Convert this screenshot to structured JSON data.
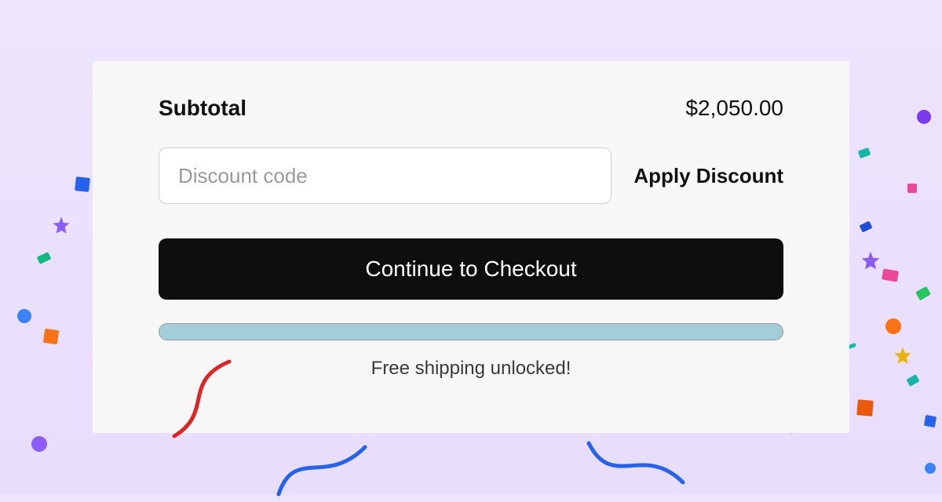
{
  "subtotal": {
    "label": "Subtotal",
    "amount": "$2,050.00"
  },
  "discount": {
    "placeholder": "Discount code",
    "apply_label": "Apply Discount"
  },
  "checkout_label": "Continue to Checkout",
  "free_shipping_label": "Free shipping unlocked!"
}
